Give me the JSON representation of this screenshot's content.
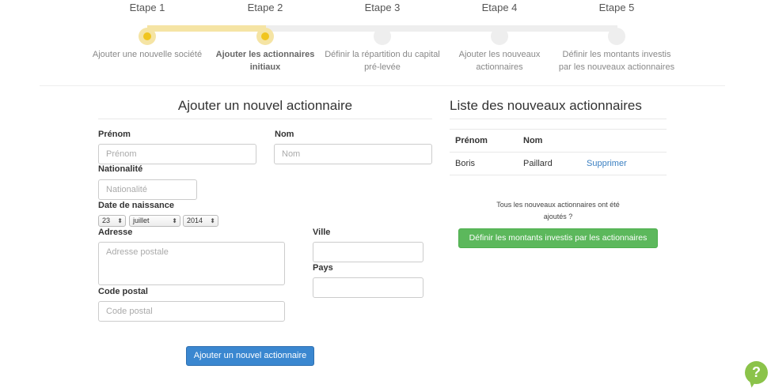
{
  "stepper": {
    "steps": [
      {
        "title": "Etape 1",
        "desc_line1": "Ajouter une nouvelle société",
        "desc_line2": ""
      },
      {
        "title": "Etape 2",
        "desc_line1": "Ajouter les actionnaires",
        "desc_line2": "initiaux"
      },
      {
        "title": "Etape 3",
        "desc_line1": "Définir la répartition du capital",
        "desc_line2": "pré-levée"
      },
      {
        "title": "Etape 4",
        "desc_line1": "Ajouter les nouveaux",
        "desc_line2": "actionnaires"
      },
      {
        "title": "Etape 5",
        "desc_line1": "Définir les montants investis",
        "desc_line2": "par les nouveaux actionnaires"
      }
    ],
    "accent_color": "#f0c520"
  },
  "form": {
    "title": "Ajouter un nouvel actionnaire",
    "first_name": {
      "label": "Prénom",
      "placeholder": "Prénom",
      "value": ""
    },
    "last_name": {
      "label": "Nom",
      "placeholder": "Nom",
      "value": ""
    },
    "nationality": {
      "label": "Nationalité",
      "placeholder": "Nationalité",
      "value": ""
    },
    "birth_date": {
      "label": "Date de naissance",
      "day": "23",
      "month": "juillet",
      "year": "2014"
    },
    "address": {
      "label": "Adresse",
      "placeholder": "Adresse postale",
      "value": ""
    },
    "city": {
      "label": "Ville",
      "placeholder": "",
      "value": ""
    },
    "country": {
      "label": "Pays",
      "placeholder": "",
      "value": ""
    },
    "postal_code": {
      "label": "Code postal",
      "placeholder": "Code postal",
      "value": ""
    },
    "submit_label": "Ajouter un nouvel actionnaire"
  },
  "list": {
    "title": "Liste des nouveaux actionnaires",
    "columns": [
      "Prénom",
      "Nom"
    ],
    "rows": [
      {
        "first_name": "Boris",
        "last_name": "Paillard",
        "action": "Supprimer"
      }
    ],
    "done_message_line1": "Tous les nouveaux actionnaires ont été",
    "done_message_line2": "ajoutés ?",
    "next_label": "Définir les montants investis par les actionnaires"
  },
  "help": {
    "icon": "question-icon",
    "glyph": "?",
    "color": "#8bc34a"
  },
  "colors": {
    "primary": "#3a87d0",
    "success": "#5cb85c",
    "link": "#3a7fc1"
  }
}
